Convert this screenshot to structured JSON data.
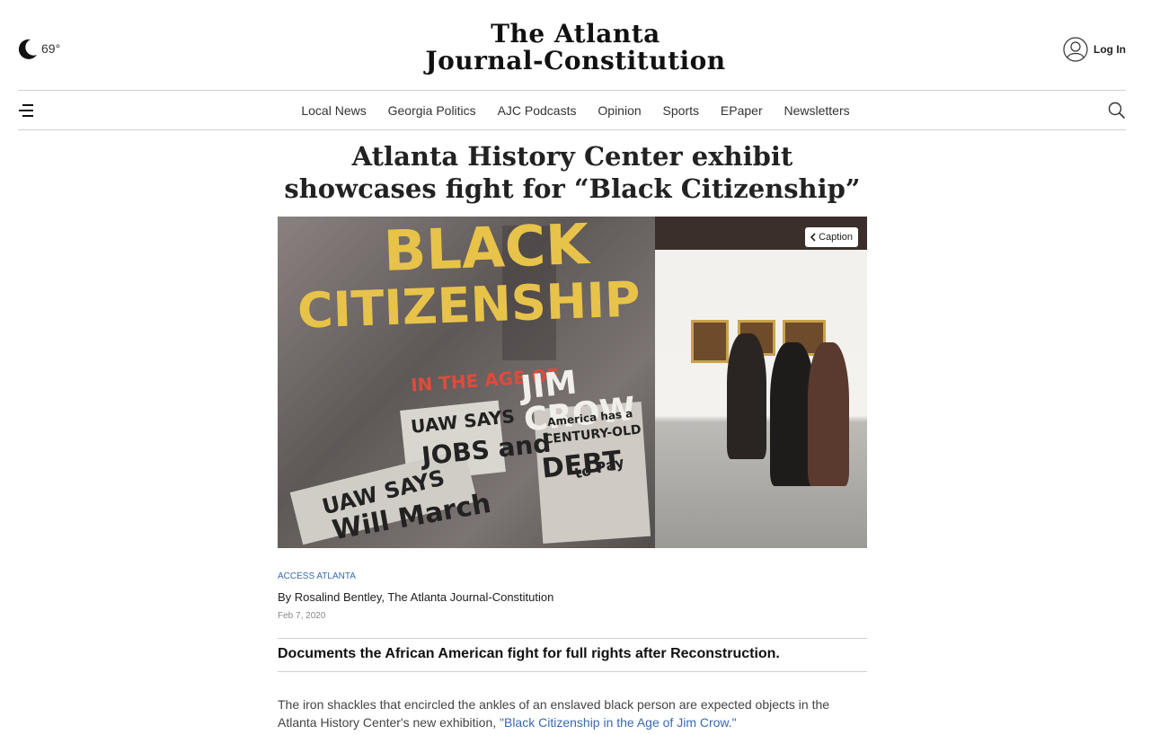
{
  "header": {
    "weather": {
      "icon": "moon-icon",
      "temperature": "69°"
    },
    "masthead": {
      "line1": "The Atlanta",
      "line2": "Journal-Constitution"
    },
    "login_label": "Log In"
  },
  "nav": {
    "items": [
      "Local News",
      "Georgia Politics",
      "AJC Podcasts",
      "Opinion",
      "Sports",
      "EPaper",
      "Newsletters"
    ]
  },
  "article": {
    "headline": "Atlanta History Center exhibit showcases fight for “Black Citizenship”",
    "caption_button": "Caption",
    "photo_text": {
      "big1": "BLACK",
      "big2": "CITIZENSHIP",
      "red": "IN THE AGE OF",
      "jimcrow": "JIM CROW",
      "uaw": "UAW SAYS",
      "jobs": "JOBS and",
      "march": "Will March",
      "debt1": "America has a",
      "debt2": "CENTURY-OLD",
      "debt3": "DEBT",
      "debt4": "to Pay",
      "uaw2": "UAW SAYS"
    },
    "section": "ACCESS ATLANTA",
    "byline": "By Rosalind Bentley, The Atlanta Journal-Constitution",
    "date": "Feb 7, 2020",
    "subhead": "Documents the African American fight for full rights after Reconstruction.",
    "body_text": "The iron shackles that encircled the ankles of an enslaved black person are expected objects in the Atlanta History Center's new exhibition, ",
    "body_link": "\"Black Citizenship in the Age of Jim Crow.\""
  },
  "colors": {
    "link": "#3a6ab0",
    "rule": "#cfcfcf",
    "sign_yellow": "#e8c34a",
    "sign_red": "#e04a3c"
  }
}
